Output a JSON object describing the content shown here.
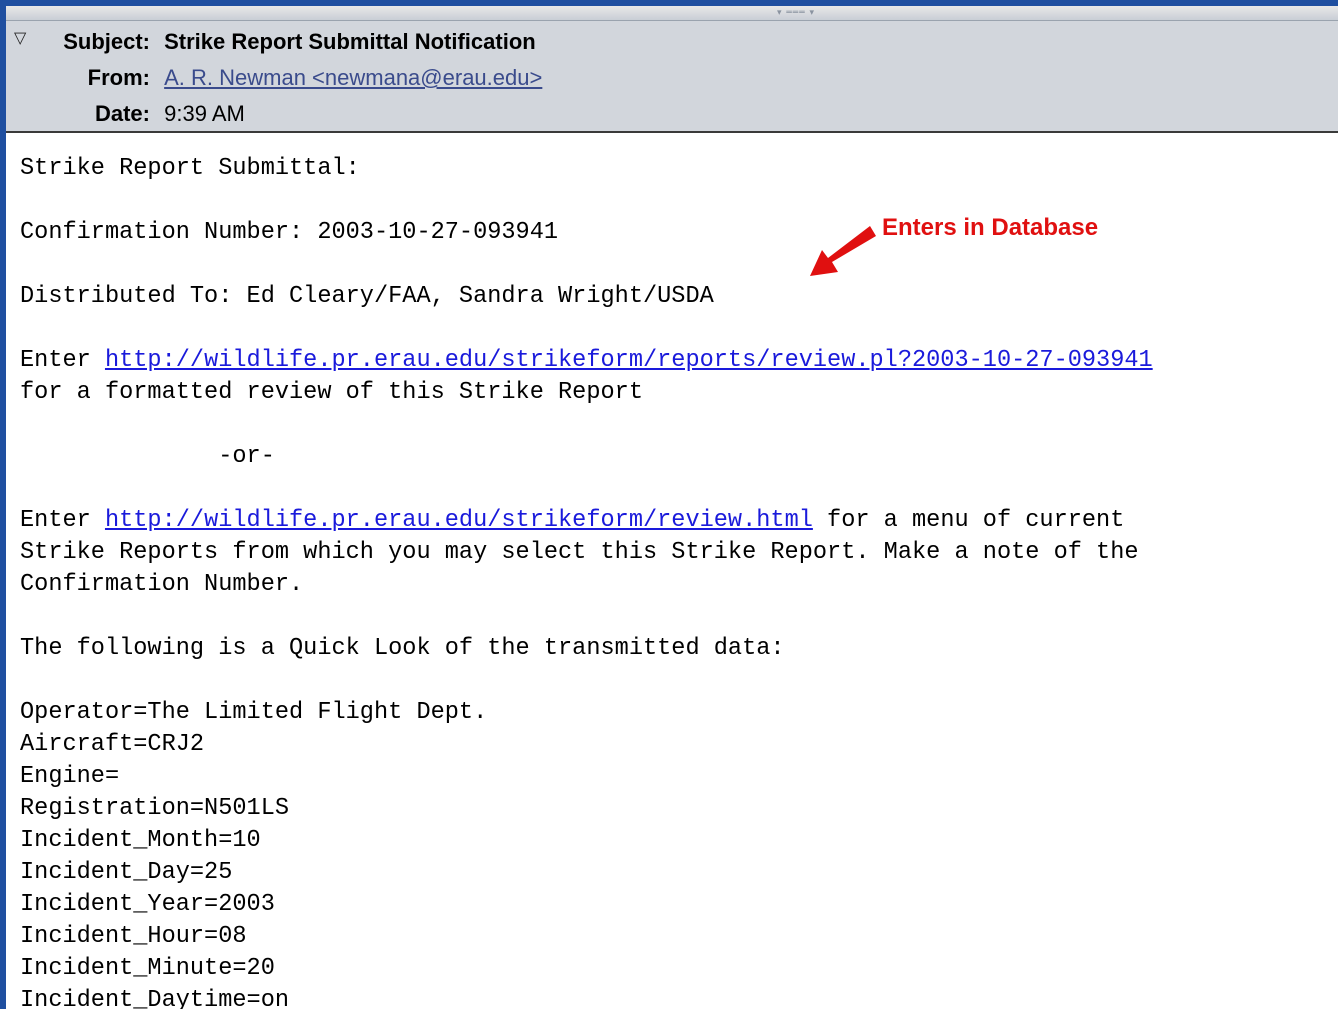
{
  "header": {
    "subject_label": "Subject:",
    "subject": "Strike Report Submittal Notification",
    "from_label": "From:",
    "from": "A. R. Newman <newmana@erau.edu>",
    "date_label": "Date:",
    "date": "9:39 AM"
  },
  "annotation": "Enters in Database",
  "body": {
    "line1": "Strike Report Submittal:",
    "confirmation": "Confirmation Number: 2003-10-27-093941",
    "distributed": "Distributed To: Ed Cleary/FAA, Sandra Wright/USDA",
    "enter_word": "Enter ",
    "review_link": "http://wildlife.pr.erau.edu/strikeform/reports/review.pl?2003-10-27-093941",
    "review_link_suffix": "for a formatted review of this Strike Report",
    "or": "              -or-",
    "menu_link": "http://wildlife.pr.erau.edu/strikeform/review.html",
    "menu_suffix": " for a menu of current",
    "menu_line2": "Strike Reports from which you may select this Strike Report. Make a note of the",
    "menu_line3": "Confirmation Number.",
    "quicklook": "The following is a Quick Look of the transmitted data:",
    "fields": [
      "Operator=The Limited Flight Dept.",
      "Aircraft=CRJ2",
      "Engine=",
      "Registration=N501LS",
      "Incident_Month=10",
      "Incident_Day=25",
      "Incident_Year=2003",
      "Incident_Hour=08",
      "Incident_Minute=20",
      "Incident_Daytime=on"
    ]
  },
  "colors": {
    "header_bg": "#d2d6dc",
    "link": "#1a1adb",
    "annotation": "#e01010",
    "desktop": "#1f4fa0"
  },
  "icons": {
    "twisty": "triangle-down-icon",
    "splitter_grip": "grip-icon"
  }
}
